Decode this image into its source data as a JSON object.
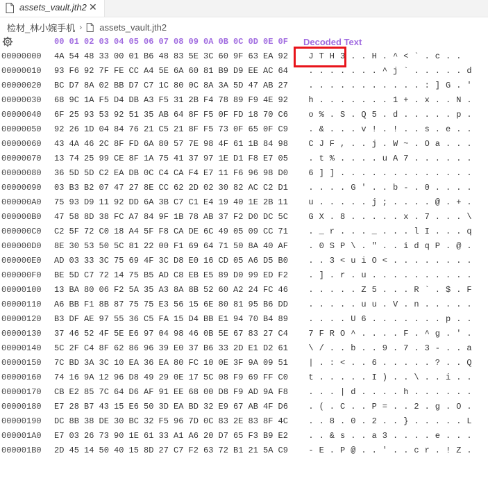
{
  "tab": {
    "title": "assets_vault.jth2",
    "close_glyph": "✕"
  },
  "breadcrumb": {
    "folder": "检材_林小婉手机",
    "separator": "›",
    "file": "assets_vault.jth2"
  },
  "header": {
    "columns": [
      "00",
      "01",
      "02",
      "03",
      "04",
      "05",
      "06",
      "07",
      "08",
      "09",
      "0A",
      "0B",
      "0C",
      "0D",
      "0E",
      "0F"
    ],
    "decoded_label": "Decoded Text"
  },
  "colors": {
    "accent": "#a06be0",
    "highlight": "#e8141b"
  },
  "rows": [
    {
      "addr": "00000000",
      "hex": [
        "4A",
        "54",
        "48",
        "33",
        "00",
        "01",
        "B6",
        "48",
        "83",
        "5E",
        "3C",
        "60",
        "9F",
        "63",
        "EA",
        "92"
      ],
      "dec": "JTH3..H.^<`.c.."
    },
    {
      "addr": "00000010",
      "hex": [
        "93",
        "F6",
        "92",
        "7F",
        "FE",
        "CC",
        "A4",
        "5E",
        "6A",
        "60",
        "81",
        "B9",
        "D9",
        "EE",
        "AC",
        "64"
      ],
      "dec": ".......^j`.....d"
    },
    {
      "addr": "00000020",
      "hex": [
        "BC",
        "D7",
        "8A",
        "02",
        "BB",
        "D7",
        "C7",
        "1C",
        "80",
        "0C",
        "8A",
        "3A",
        "5D",
        "47",
        "AB",
        "27"
      ],
      "dec": "...........:]G.'"
    },
    {
      "addr": "00000030",
      "hex": [
        "68",
        "9C",
        "1A",
        "F5",
        "D4",
        "DB",
        "A3",
        "F5",
        "31",
        "2B",
        "F4",
        "78",
        "89",
        "F9",
        "4E",
        "92"
      ],
      "dec": "h.......1+.x..N."
    },
    {
      "addr": "00000040",
      "hex": [
        "6F",
        "25",
        "93",
        "53",
        "92",
        "51",
        "35",
        "AB",
        "64",
        "8F",
        "F5",
        "0F",
        "FD",
        "18",
        "70",
        "C6"
      ],
      "dec": "o%.S.Q5.d.....p."
    },
    {
      "addr": "00000050",
      "hex": [
        "92",
        "26",
        "1D",
        "04",
        "84",
        "76",
        "21",
        "C5",
        "21",
        "8F",
        "F5",
        "73",
        "0F",
        "65",
        "0F",
        "C9"
      ],
      "dec": ".&...v!.!..s.e.."
    },
    {
      "addr": "00000060",
      "hex": [
        "43",
        "4A",
        "46",
        "2C",
        "8F",
        "FD",
        "6A",
        "80",
        "57",
        "7E",
        "98",
        "4F",
        "61",
        "1B",
        "84",
        "98"
      ],
      "dec": "CJF,..j.W~.Oa..."
    },
    {
      "addr": "00000070",
      "hex": [
        "13",
        "74",
        "25",
        "99",
        "CE",
        "8F",
        "1A",
        "75",
        "41",
        "37",
        "97",
        "1E",
        "D1",
        "F8",
        "E7",
        "05"
      ],
      "dec": ".t%....uA7......"
    },
    {
      "addr": "00000080",
      "hex": [
        "36",
        "5D",
        "5D",
        "C2",
        "EA",
        "DB",
        "0C",
        "C4",
        "CA",
        "F4",
        "E7",
        "11",
        "F6",
        "96",
        "98",
        "D0"
      ],
      "dec": "6]]............."
    },
    {
      "addr": "00000090",
      "hex": [
        "03",
        "B3",
        "B2",
        "07",
        "47",
        "27",
        "8E",
        "CC",
        "62",
        "2D",
        "02",
        "30",
        "82",
        "AC",
        "C2",
        "D1"
      ],
      "dec": "....G'..b-.0...."
    },
    {
      "addr": "000000A0",
      "hex": [
        "75",
        "93",
        "D9",
        "11",
        "92",
        "DD",
        "6A",
        "3B",
        "C7",
        "C1",
        "E4",
        "19",
        "40",
        "1E",
        "2B",
        "11"
      ],
      "dec": "u.....j;....@.+."
    },
    {
      "addr": "000000B0",
      "hex": [
        "47",
        "58",
        "8D",
        "38",
        "FC",
        "A7",
        "84",
        "9F",
        "1B",
        "78",
        "AB",
        "37",
        "F2",
        "D0",
        "DC",
        "5C"
      ],
      "dec": "GX.8.....x.7...\\"
    },
    {
      "addr": "000000C0",
      "hex": [
        "C2",
        "5F",
        "72",
        "C0",
        "18",
        "A4",
        "5F",
        "F8",
        "CA",
        "DE",
        "6C",
        "49",
        "05",
        "09",
        "CC",
        "71"
      ],
      "dec": "._r..._...lI...q"
    },
    {
      "addr": "000000D0",
      "hex": [
        "8E",
        "30",
        "53",
        "50",
        "5C",
        "81",
        "22",
        "00",
        "F1",
        "69",
        "64",
        "71",
        "50",
        "8A",
        "40",
        "AF"
      ],
      "dec": ".0SP\\.\"..idqP.@."
    },
    {
      "addr": "000000E0",
      "hex": [
        "AD",
        "03",
        "33",
        "3C",
        "75",
        "69",
        "4F",
        "3C",
        "D8",
        "E0",
        "16",
        "CD",
        "05",
        "A6",
        "D5",
        "B0"
      ],
      "dec": "..3<uiO<........"
    },
    {
      "addr": "000000F0",
      "hex": [
        "BE",
        "5D",
        "C7",
        "72",
        "14",
        "75",
        "B5",
        "AD",
        "C8",
        "EB",
        "E5",
        "89",
        "D0",
        "99",
        "ED",
        "F2"
      ],
      "dec": ".].r.u.........."
    },
    {
      "addr": "00000100",
      "hex": [
        "13",
        "BA",
        "80",
        "06",
        "F2",
        "5A",
        "35",
        "A3",
        "8A",
        "8B",
        "52",
        "60",
        "A2",
        "24",
        "FC",
        "46"
      ],
      "dec": ".....Z5...R`.$.F"
    },
    {
      "addr": "00000110",
      "hex": [
        "A6",
        "BB",
        "F1",
        "8B",
        "87",
        "75",
        "75",
        "E3",
        "56",
        "15",
        "6E",
        "80",
        "81",
        "95",
        "B6",
        "DD"
      ],
      "dec": ".....uu.V.n....."
    },
    {
      "addr": "00000120",
      "hex": [
        "B3",
        "DF",
        "AE",
        "97",
        "55",
        "36",
        "C5",
        "FA",
        "15",
        "D4",
        "BB",
        "E1",
        "94",
        "70",
        "B4",
        "89"
      ],
      "dec": "....U6.......p.."
    },
    {
      "addr": "00000130",
      "hex": [
        "37",
        "46",
        "52",
        "4F",
        "5E",
        "E6",
        "97",
        "04",
        "98",
        "46",
        "0B",
        "5E",
        "67",
        "83",
        "27",
        "C4"
      ],
      "dec": "7FRO^....F.^g.'."
    },
    {
      "addr": "00000140",
      "hex": [
        "5C",
        "2F",
        "C4",
        "8F",
        "62",
        "86",
        "96",
        "39",
        "E0",
        "37",
        "B6",
        "33",
        "2D",
        "E1",
        "D2",
        "61"
      ],
      "dec": "\\/..b..9.7.3-..a"
    },
    {
      "addr": "00000150",
      "hex": [
        "7C",
        "BD",
        "3A",
        "3C",
        "10",
        "EA",
        "36",
        "EA",
        "80",
        "FC",
        "10",
        "0E",
        "3F",
        "9A",
        "09",
        "51"
      ],
      "dec": "|.:<..6.....?..Q"
    },
    {
      "addr": "00000160",
      "hex": [
        "74",
        "16",
        "9A",
        "12",
        "96",
        "D8",
        "49",
        "29",
        "0E",
        "17",
        "5C",
        "08",
        "F9",
        "69",
        "FF",
        "C0"
      ],
      "dec": "t.....I)..\\..i.."
    },
    {
      "addr": "00000170",
      "hex": [
        "CB",
        "E2",
        "85",
        "7C",
        "64",
        "D6",
        "AF",
        "91",
        "EE",
        "68",
        "00",
        "D8",
        "F9",
        "AD",
        "9A",
        "F8"
      ],
      "dec": "...|d....h......"
    },
    {
      "addr": "00000180",
      "hex": [
        "E7",
        "28",
        "B7",
        "43",
        "15",
        "E6",
        "50",
        "3D",
        "EA",
        "BD",
        "32",
        "E9",
        "67",
        "AB",
        "4F",
        "D6"
      ],
      "dec": ".(.C..P=..2.g.O."
    },
    {
      "addr": "00000190",
      "hex": [
        "DC",
        "8B",
        "38",
        "DE",
        "30",
        "BC",
        "32",
        "F5",
        "96",
        "7D",
        "0C",
        "83",
        "2E",
        "83",
        "8F",
        "4C"
      ],
      "dec": "..8.0.2..}.....L"
    },
    {
      "addr": "000001A0",
      "hex": [
        "E7",
        "03",
        "26",
        "73",
        "90",
        "1E",
        "61",
        "33",
        "A1",
        "A6",
        "20",
        "D7",
        "65",
        "F3",
        "B9",
        "E2"
      ],
      "dec": "..&s..a3....e..."
    },
    {
      "addr": "000001B0",
      "hex": [
        "2D",
        "45",
        "14",
        "50",
        "40",
        "15",
        "8D",
        "27",
        "C7",
        "F2",
        "63",
        "72",
        "B1",
        "21",
        "5A",
        "C9"
      ],
      "dec": "-E.P@..'..cr.!Z."
    }
  ]
}
